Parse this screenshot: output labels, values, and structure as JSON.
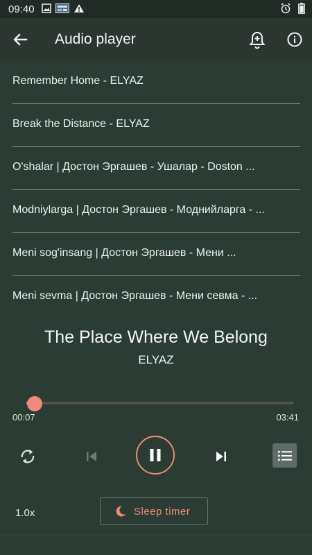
{
  "status_bar": {
    "time": "09:40",
    "left_icons": [
      "image-icon",
      "news-icon",
      "warning-icon"
    ],
    "right_icons": [
      "alarm-icon",
      "battery-icon"
    ]
  },
  "app_bar": {
    "title": "Audio player",
    "icons": [
      "back-arrow-icon",
      "bell-plus-icon",
      "info-icon"
    ]
  },
  "playlist": [
    {
      "label": "Remember Home - ELYAZ"
    },
    {
      "label": "Break the Distance - ELYAZ"
    },
    {
      "label": "O'shalar | Достон Эргашев - Ушалар - Doston ..."
    },
    {
      "label": "Modniylarga | Достон Эргашев - Моднийларга - ..."
    },
    {
      "label": "Meni sog'insang | Достон Эргашев - Мени ..."
    },
    {
      "label": "Meni sevma | Достон Эргашев - Мени севма - ..."
    }
  ],
  "now_playing": {
    "title": "The Place Where We Belong",
    "artist": "ELYAZ",
    "current_time": "00:07",
    "total_time": "03:41",
    "progress_fraction": 0.03
  },
  "controls": {
    "speed": "1.0x",
    "sleep_timer_label": "Sleep timer",
    "icons": [
      "repeat-icon",
      "previous-icon",
      "pause-icon",
      "next-icon",
      "queue-icon",
      "moon-icon"
    ]
  },
  "colors": {
    "background": "#2a3c33",
    "app_bar": "#2b3630",
    "accent": "#f08a7a",
    "divider": "#7f8d86"
  }
}
